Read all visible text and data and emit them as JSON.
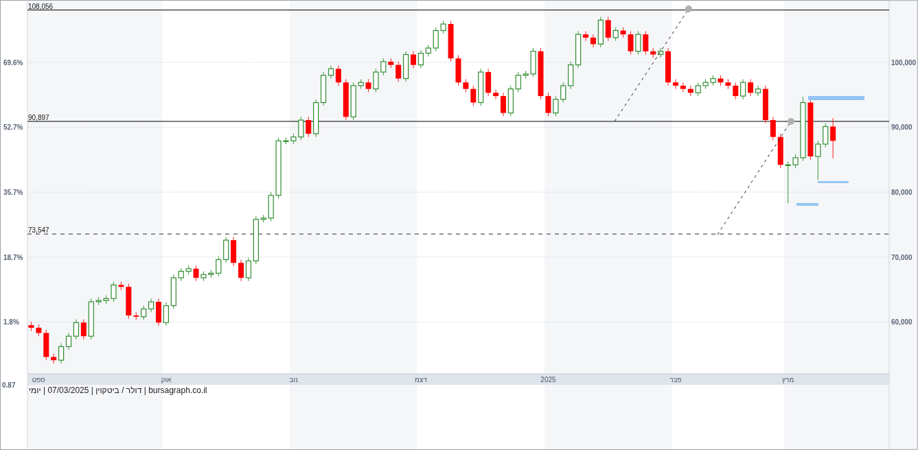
{
  "chart": {
    "chart_data": {
      "type": "candlestick",
      "categories": [
        null,
        "ספט",
        null,
        null,
        null,
        null,
        null,
        null,
        null,
        null,
        null,
        null,
        null,
        null,
        null,
        null,
        null,
        null,
        "אוק",
        null,
        null,
        null,
        null,
        null,
        null,
        null,
        null,
        null,
        null,
        null,
        null,
        null,
        null,
        null,
        null,
        "נוב",
        null,
        null,
        null,
        null,
        null,
        null,
        null,
        null,
        null,
        null,
        null,
        null,
        null,
        null,
        null,
        null,
        "דצמ",
        null,
        null,
        null,
        null,
        null,
        null,
        null,
        null,
        null,
        null,
        null,
        null,
        null,
        null,
        null,
        null,
        "2025",
        null,
        null,
        null,
        null,
        null,
        null,
        null,
        null,
        null,
        null,
        null,
        null,
        null,
        null,
        null,
        null,
        "פבר",
        null,
        null,
        null,
        null,
        null,
        null,
        null,
        null,
        null,
        null,
        null,
        null,
        null,
        null,
        "מרץ",
        null,
        null,
        null,
        null,
        null,
        null,
        null,
        null,
        null,
        null,
        null,
        null,
        null
      ],
      "ohlc": [
        [
          59500,
          60000,
          58600,
          59100
        ],
        [
          59100,
          59600,
          57800,
          58300
        ],
        [
          58300,
          58800,
          54100,
          54600
        ],
        [
          54600,
          55100,
          53600,
          54100
        ],
        [
          54100,
          56700,
          53600,
          56200
        ],
        [
          56200,
          58300,
          55700,
          57800
        ],
        [
          57800,
          60400,
          57300,
          59900
        ],
        [
          59900,
          60400,
          57300,
          57800
        ],
        [
          57800,
          63600,
          57300,
          63100
        ],
        [
          63100,
          63800,
          62600,
          63300
        ],
        [
          63300,
          64100,
          62800,
          63600
        ],
        [
          63600,
          66200,
          63100,
          65700
        ],
        [
          65700,
          66200,
          64900,
          65400
        ],
        [
          65400,
          65900,
          60500,
          61000
        ],
        [
          61000,
          61500,
          60300,
          60800
        ],
        [
          60800,
          62500,
          60300,
          62000
        ],
        [
          62000,
          63600,
          61500,
          63100
        ],
        [
          63100,
          63600,
          59400,
          59900
        ],
        [
          59900,
          63000,
          59400,
          62500
        ],
        [
          62500,
          67300,
          62000,
          66800
        ],
        [
          66800,
          68300,
          66300,
          67800
        ],
        [
          67800,
          68700,
          67300,
          68200
        ],
        [
          68200,
          68700,
          66300,
          66800
        ],
        [
          66800,
          67800,
          66300,
          67300
        ],
        [
          67300,
          68000,
          66800,
          67500
        ],
        [
          67500,
          70100,
          67000,
          69600
        ],
        [
          69600,
          73100,
          69100,
          72600
        ],
        [
          72600,
          73100,
          68600,
          69100
        ],
        [
          69100,
          69600,
          66300,
          66800
        ],
        [
          66800,
          69900,
          66300,
          69400
        ],
        [
          69400,
          76300,
          68900,
          75800
        ],
        [
          75800,
          76500,
          75300,
          76000
        ],
        [
          76000,
          80000,
          75500,
          79500
        ],
        [
          79500,
          88400,
          79000,
          87900
        ],
        [
          87900,
          88400,
          87400,
          87900
        ],
        [
          87900,
          89000,
          87400,
          88500
        ],
        [
          88500,
          91600,
          88000,
          91100
        ],
        [
          91100,
          91600,
          88500,
          89000
        ],
        [
          89000,
          94300,
          88500,
          93800
        ],
        [
          93800,
          98500,
          93300,
          98000
        ],
        [
          98000,
          99500,
          97500,
          99000
        ],
        [
          99000,
          99500,
          96400,
          96900
        ],
        [
          96900,
          97400,
          91100,
          91600
        ],
        [
          91600,
          96900,
          91100,
          96400
        ],
        [
          96400,
          97400,
          95900,
          96900
        ],
        [
          96900,
          97400,
          95400,
          95900
        ],
        [
          95900,
          99000,
          95400,
          98500
        ],
        [
          98500,
          100600,
          98000,
          100100
        ],
        [
          100100,
          100600,
          99100,
          99600
        ],
        [
          99600,
          100100,
          97000,
          97500
        ],
        [
          97500,
          101700,
          97000,
          101200
        ],
        [
          101200,
          101700,
          99100,
          99600
        ],
        [
          99600,
          101900,
          99100,
          101400
        ],
        [
          101400,
          102700,
          100900,
          102200
        ],
        [
          102200,
          105400,
          101700,
          104900
        ],
        [
          104900,
          106400,
          104400,
          105900
        ],
        [
          105900,
          106400,
          100100,
          100600
        ],
        [
          100600,
          101100,
          96400,
          96900
        ],
        [
          96900,
          97400,
          95400,
          95900
        ],
        [
          95900,
          96400,
          93300,
          93800
        ],
        [
          93800,
          99000,
          93300,
          98500
        ],
        [
          98500,
          99000,
          94800,
          95300
        ],
        [
          95300,
          95800,
          94300,
          94800
        ],
        [
          94800,
          95300,
          91700,
          92200
        ],
        [
          92200,
          96400,
          91700,
          95900
        ],
        [
          95900,
          98500,
          95400,
          98000
        ],
        [
          98000,
          98700,
          97500,
          98200
        ],
        [
          98200,
          102200,
          97700,
          101700
        ],
        [
          101700,
          102200,
          94300,
          94800
        ],
        [
          94800,
          95300,
          91700,
          92200
        ],
        [
          92200,
          94800,
          91700,
          94300
        ],
        [
          94300,
          96900,
          93800,
          96400
        ],
        [
          96400,
          100100,
          95900,
          99600
        ],
        [
          99600,
          104800,
          99100,
          104300
        ],
        [
          104300,
          104800,
          103300,
          103800
        ],
        [
          103800,
          104300,
          102300,
          102800
        ],
        [
          102800,
          107000,
          102300,
          106500
        ],
        [
          106500,
          107000,
          103300,
          103800
        ],
        [
          103800,
          105400,
          103300,
          104900
        ],
        [
          104900,
          105400,
          103800,
          104300
        ],
        [
          104300,
          104800,
          101200,
          101700
        ],
        [
          101700,
          104800,
          101200,
          104300
        ],
        [
          104300,
          104800,
          101200,
          101700
        ],
        [
          101700,
          102200,
          100700,
          101200
        ],
        [
          101200,
          102200,
          100700,
          101700
        ],
        [
          101700,
          102200,
          96400,
          96900
        ],
        [
          96900,
          97400,
          95900,
          96400
        ],
        [
          96400,
          96900,
          95400,
          95900
        ],
        [
          95900,
          96400,
          94800,
          95300
        ],
        [
          95300,
          96900,
          94800,
          96400
        ],
        [
          96400,
          97400,
          95900,
          96900
        ],
        [
          96900,
          98000,
          96400,
          97500
        ],
        [
          97500,
          98000,
          96400,
          96900
        ],
        [
          96900,
          97400,
          95900,
          96400
        ],
        [
          96400,
          96900,
          94300,
          94800
        ],
        [
          94800,
          97400,
          94300,
          96900
        ],
        [
          96900,
          97400,
          94800,
          95300
        ],
        [
          95300,
          96400,
          94800,
          95900
        ],
        [
          95900,
          96400,
          90600,
          91100
        ],
        [
          91100,
          91600,
          88000,
          88500
        ],
        [
          88500,
          89000,
          83700,
          84200
        ],
        [
          84200,
          84700,
          78300,
          84200
        ],
        [
          84200,
          85800,
          83700,
          85300
        ],
        [
          85300,
          94700,
          84800,
          93800
        ],
        [
          93800,
          94300,
          85000,
          85500
        ],
        [
          85500,
          87900,
          81900,
          87400
        ],
        [
          87400,
          90600,
          86900,
          90100
        ],
        [
          90100,
          91400,
          85200,
          87900
        ],
        null,
        null,
        null,
        null,
        null,
        null,
        null
      ],
      "yticks": [
        {
          "value": 100000,
          "label": "100,000"
        },
        {
          "value": 90000,
          "label": "90,000"
        },
        {
          "value": 80000,
          "label": "80,000"
        },
        {
          "value": 70000,
          "label": "70,000"
        },
        {
          "value": 60000,
          "label": "60,000"
        }
      ],
      "ylim": [
        52000,
        109600
      ],
      "grid": true,
      "ref_lines": [
        {
          "axis": "y",
          "value": 108056,
          "label": "108,056"
        },
        {
          "axis": "y",
          "value": 90897,
          "label": "90,897"
        },
        {
          "axis": "y",
          "value": 73547,
          "label": "73,547"
        }
      ]
    },
    "left_axis_labels": [
      "69.6%",
      "52.7%",
      "35.7%",
      "18.7%",
      "1.8%"
    ],
    "bottom_left_label": "0.87",
    "footer": "bursagraph.co.il | דולר / ביטקוין | 07/03/2025 | יומי"
  }
}
